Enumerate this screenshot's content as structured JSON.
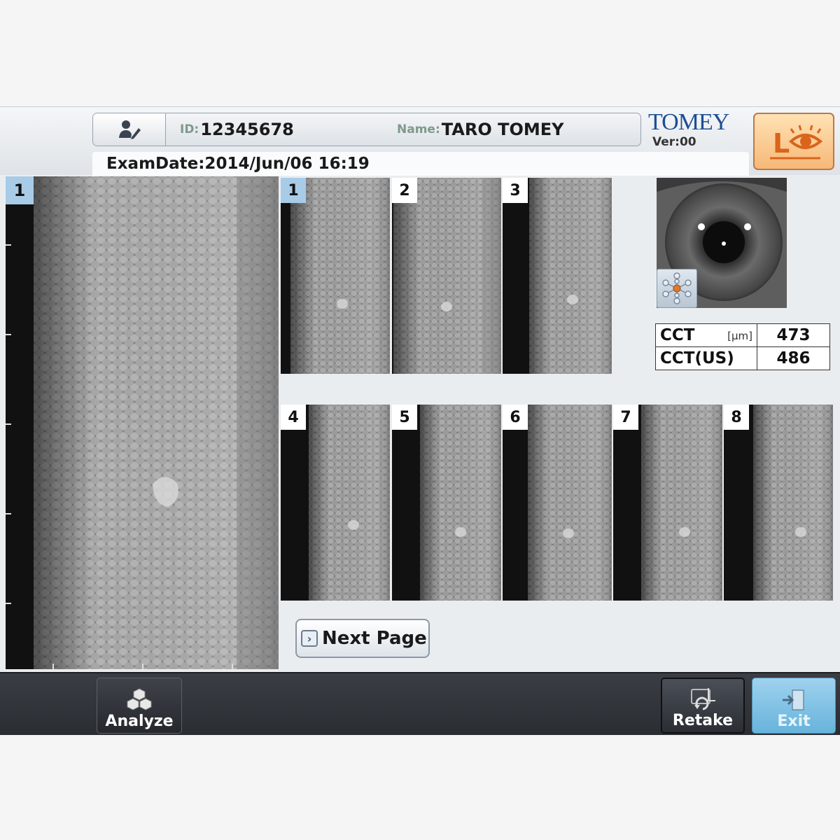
{
  "header": {
    "id_label": "ID:",
    "id_value": "12345678",
    "name_label": "Name:",
    "name_value": "TARO TOMEY",
    "brand": "TOMEY",
    "version": "Ver:00",
    "eye_side": "L",
    "exam_date": "ExamDate:2014/Jun/06 16:19"
  },
  "main_image": {
    "number": "1"
  },
  "thumbnails": [
    {
      "number": "1",
      "selected": true
    },
    {
      "number": "2",
      "selected": false
    },
    {
      "number": "3",
      "selected": false
    },
    {
      "number": "4",
      "selected": false
    },
    {
      "number": "5",
      "selected": false
    },
    {
      "number": "6",
      "selected": false
    },
    {
      "number": "7",
      "selected": false
    },
    {
      "number": "8",
      "selected": false
    }
  ],
  "measurements": {
    "cct_label": "CCT",
    "cct_unit": "[µm]",
    "cct_value": "473",
    "cct_us_label": "CCT(US)",
    "cct_us_value": "486"
  },
  "buttons": {
    "next_page": "Next Page",
    "analyze": "Analyze",
    "retake": "Retake",
    "exit": "Exit"
  },
  "colors": {
    "selected_badge": "#a8cce8",
    "brand": "#1d4f94",
    "eye_button": "#f6b877",
    "exit_button": "#67b3dc"
  }
}
